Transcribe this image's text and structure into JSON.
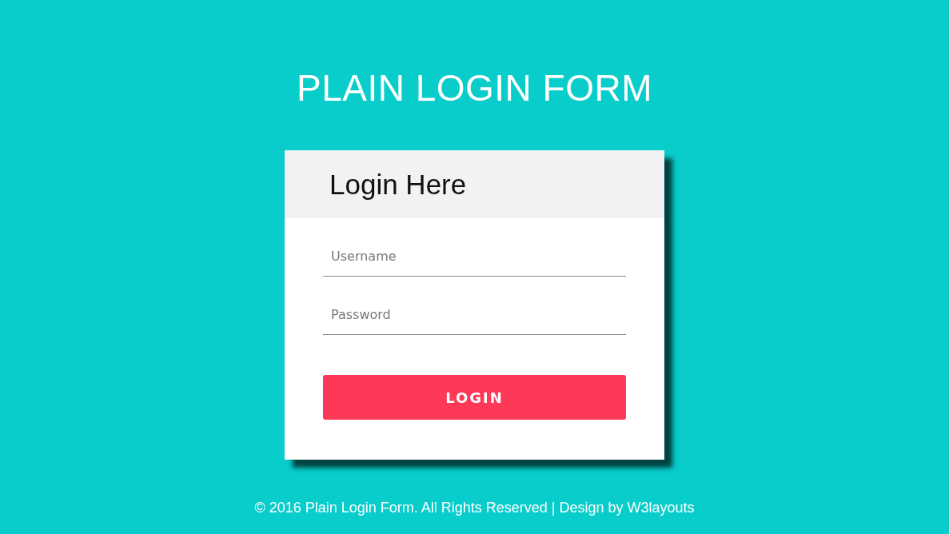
{
  "heading": "PLAIN LOGIN FORM",
  "form": {
    "title": "Login Here",
    "fields": [
      {
        "placeholder": "Username"
      },
      {
        "placeholder": "Password"
      }
    ],
    "button": "LOGIN"
  },
  "footer": "© 2016 Plain Login Form. All Rights Reserved | Design by W3layouts"
}
